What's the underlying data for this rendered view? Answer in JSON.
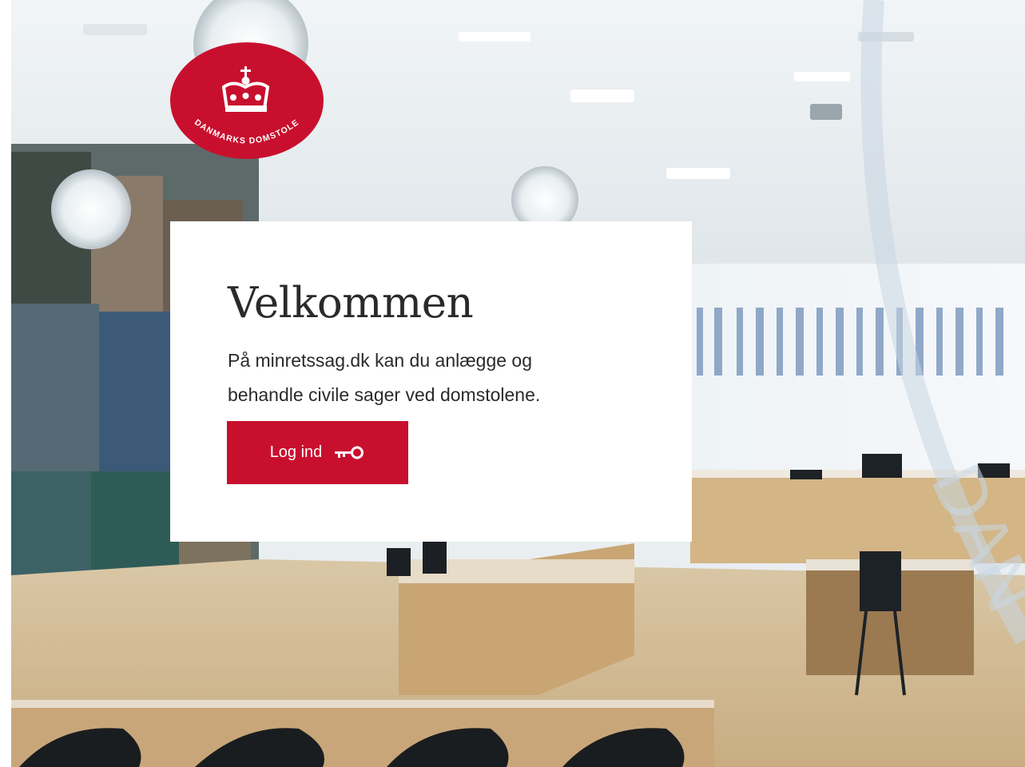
{
  "brand": {
    "name": "DANMARKS DOMSTOLE",
    "color": "#c8102e",
    "logo_icon": "crown-icon"
  },
  "welcome": {
    "title": "Velkommen",
    "line1": "På minretssag.dk kan du anlægge og",
    "line2": "behandle civile sager ved domstolene."
  },
  "login": {
    "label": "Log ind",
    "icon": "key-icon"
  },
  "colors": {
    "button": "#c8102e",
    "card": "#ffffff",
    "text": "#2a2a2a"
  }
}
